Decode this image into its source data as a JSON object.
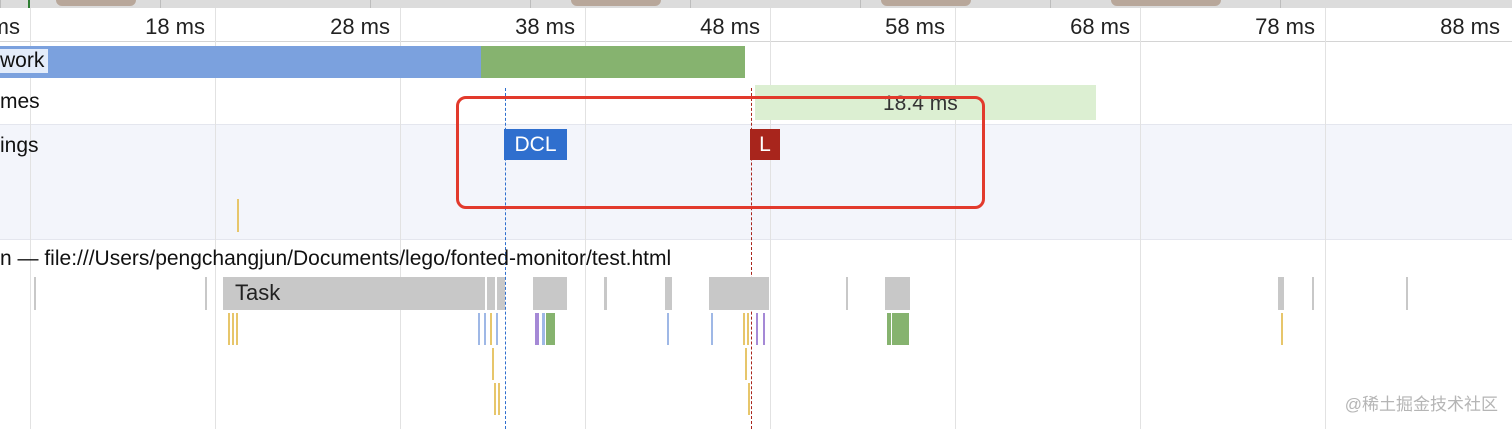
{
  "ruler": {
    "tick_labels": [
      "ms",
      "18 ms",
      "28 ms",
      "38 ms",
      "48 ms",
      "58 ms",
      "68 ms",
      "78 ms",
      "88 ms"
    ]
  },
  "tracks": {
    "network_label": "work",
    "frames_label": "mes",
    "frame_duration": "18.4 ms",
    "timings_label": "ings"
  },
  "markers": {
    "dcl_label": "DCL",
    "load_label": "L",
    "dcl_color": "#2f6fce",
    "load_color": "#a8251c"
  },
  "main_thread": {
    "title": "n — file:///Users/pengchangjun/Documents/lego/fonted-monitor/test.html",
    "task_label": "Task"
  },
  "colors": {
    "network_blue": "#7ba1de",
    "network_green": "#86b36f",
    "frame_green": "#dcefd2",
    "highlight_red": "#e23a2c",
    "task_gray": "#c8c8c8"
  },
  "watermark": "@稀土掘金技术社区"
}
